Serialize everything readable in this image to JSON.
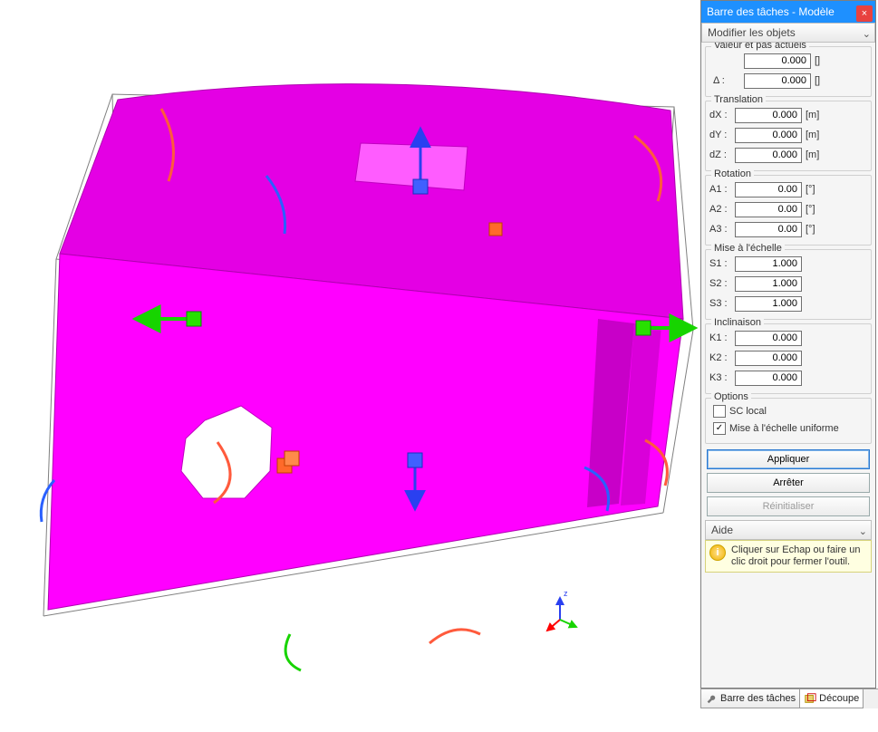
{
  "panel": {
    "title": "Barre des tâches - Modèle",
    "section_toggle": "Modifier les objets"
  },
  "value_step": {
    "label": "Valeur et pas actuels",
    "value": "0.000",
    "value_unit": "[]",
    "delta_label": "Δ :",
    "delta": "0.000",
    "delta_unit": "[]"
  },
  "translation": {
    "label": "Translation",
    "rows": [
      {
        "lbl": "dX :",
        "val": "0.000",
        "unit": "[m]"
      },
      {
        "lbl": "dY :",
        "val": "0.000",
        "unit": "[m]"
      },
      {
        "lbl": "dZ :",
        "val": "0.000",
        "unit": "[m]"
      }
    ]
  },
  "rotation": {
    "label": "Rotation",
    "rows": [
      {
        "lbl": "A1 :",
        "val": "0.00",
        "unit": "[°]"
      },
      {
        "lbl": "A2 :",
        "val": "0.00",
        "unit": "[°]"
      },
      {
        "lbl": "A3 :",
        "val": "0.00",
        "unit": "[°]"
      }
    ]
  },
  "scale": {
    "label": "Mise à l'échelle",
    "rows": [
      {
        "lbl": "S1 :",
        "val": "1.000"
      },
      {
        "lbl": "S2 :",
        "val": "1.000"
      },
      {
        "lbl": "S3 :",
        "val": "1.000"
      }
    ]
  },
  "inclination": {
    "label": "Inclinaison",
    "rows": [
      {
        "lbl": "K1 :",
        "val": "0.000"
      },
      {
        "lbl": "K2 :",
        "val": "0.000"
      },
      {
        "lbl": "K3 :",
        "val": "0.000"
      }
    ]
  },
  "options": {
    "label": "Options",
    "sc_local": "SC local",
    "uniform_scale": "Mise à l'échelle uniforme"
  },
  "buttons": {
    "apply": "Appliquer",
    "stop": "Arrêter",
    "reset": "Réinitialiser"
  },
  "help": {
    "header": "Aide",
    "text": "Cliquer sur Echap ou faire un clic droit pour fermer l'outil."
  },
  "tabs": {
    "taskbar": "Barre des tâches",
    "cut": "Découpe"
  }
}
